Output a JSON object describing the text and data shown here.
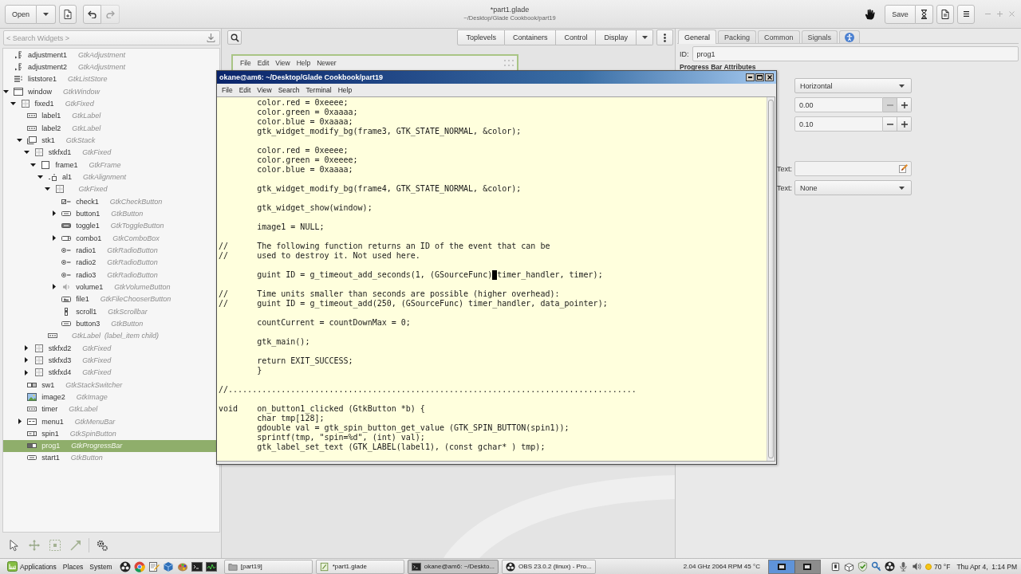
{
  "header": {
    "open_button": "Open",
    "title": "*part1.glade",
    "subtitle": "~/Desktop/Glade Cookbook/part19",
    "history": [
      {
        "kind": "undo",
        "disabled": false
      },
      {
        "kind": "redo",
        "disabled": true
      }
    ],
    "save_button": "Save"
  },
  "widget_tree": {
    "search": {
      "placeholder": "< Search Widgets >"
    },
    "items": [
      {
        "name": "adjustment1",
        "type": "GtkAdjustment",
        "kind": "adjustment",
        "selected": false
      },
      {
        "name": "adjustment2",
        "type": "GtkAdjustment",
        "kind": "adjustment",
        "selected": false
      },
      {
        "name": "liststore1",
        "type": "GtkListStore",
        "kind": "liststore",
        "selected": false
      },
      {
        "name": "window",
        "type": "GtkWindow",
        "kind": "window",
        "selected": false,
        "expanded": true,
        "children": [
          {
            "name": "fixed1",
            "type": "GtkFixed",
            "kind": "fixed",
            "selected": false,
            "expanded": true,
            "children": [
              {
                "name": "label1",
                "type": "GtkLabel",
                "kind": "label",
                "selected": false
              },
              {
                "name": "label2",
                "type": "GtkLabel",
                "kind": "label",
                "selected": false
              },
              {
                "name": "stk1",
                "type": "GtkStack",
                "kind": "stack",
                "selected": false,
                "expanded": true,
                "children": [
                  {
                    "name": "stkfxd1",
                    "type": "GtkFixed",
                    "kind": "fixed",
                    "selected": false,
                    "expanded": true,
                    "children": [
                      {
                        "name": "frame1",
                        "type": "GtkFrame",
                        "kind": "frame",
                        "selected": false,
                        "expanded": true,
                        "children": [
                          {
                            "name": "al1",
                            "type": "GtkAlignment",
                            "kind": "alignment",
                            "selected": false,
                            "expanded": true,
                            "children": [
                              {
                                "type": "GtkFixed",
                                "kind": "fixed",
                                "selected": false,
                                "expanded": true,
                                "children": [
                                  {
                                    "name": "check1",
                                    "type": "GtkCheckButton",
                                    "kind": "check",
                                    "selected": false
                                  },
                                  {
                                    "name": "button1",
                                    "type": "GtkButton",
                                    "kind": "button",
                                    "selected": false,
                                    "expanded": false
                                  },
                                  {
                                    "name": "toggle1",
                                    "type": "GtkToggleButton",
                                    "kind": "toggle",
                                    "selected": false
                                  },
                                  {
                                    "name": "combo1",
                                    "type": "GtkComboBox",
                                    "kind": "combo",
                                    "selected": false,
                                    "expanded": false
                                  },
                                  {
                                    "name": "radio1",
                                    "type": "GtkRadioButton",
                                    "kind": "radio",
                                    "selected": false
                                  },
                                  {
                                    "name": "radio2",
                                    "type": "GtkRadioButton",
                                    "kind": "radio",
                                    "selected": false
                                  },
                                  {
                                    "name": "radio3",
                                    "type": "GtkRadioButton",
                                    "kind": "radio",
                                    "selected": false
                                  },
                                  {
                                    "name": "volume1",
                                    "type": "GtkVolumeButton",
                                    "kind": "volume",
                                    "selected": false,
                                    "expanded": false
                                  },
                                  {
                                    "name": "file1",
                                    "type": "GtkFileChooserButton",
                                    "kind": "file",
                                    "selected": false
                                  },
                                  {
                                    "name": "scroll1",
                                    "type": "GtkScrollbar",
                                    "kind": "scrollbar",
                                    "selected": false
                                  },
                                  {
                                    "name": "button3",
                                    "type": "GtkButton",
                                    "kind": "button",
                                    "selected": false
                                  }
                                ]
                              }
                            ]
                          },
                          {
                            "type": "GtkLabel",
                            "note": "(label_item child)",
                            "kind": "label",
                            "selected": false
                          }
                        ]
                      }
                    ]
                  },
                  {
                    "name": "stkfxd2",
                    "type": "GtkFixed",
                    "kind": "fixed",
                    "selected": false,
                    "expanded": false
                  },
                  {
                    "name": "stkfxd3",
                    "type": "GtkFixed",
                    "kind": "fixed",
                    "selected": false,
                    "expanded": false
                  },
                  {
                    "name": "stkfxd4",
                    "type": "GtkFixed",
                    "kind": "fixed",
                    "selected": false,
                    "expanded": false
                  }
                ]
              },
              {
                "name": "sw1",
                "type": "GtkStackSwitcher",
                "kind": "switcher",
                "selected": false
              },
              {
                "name": "image2",
                "type": "GtkImage",
                "kind": "image",
                "selected": false
              },
              {
                "name": "timer",
                "type": "GtkLabel",
                "kind": "label",
                "selected": false
              },
              {
                "name": "menu1",
                "type": "GtkMenuBar",
                "kind": "menubar",
                "selected": false,
                "expanded": false
              },
              {
                "name": "spin1",
                "type": "GtkSpinButton",
                "kind": "spin",
                "selected": false
              },
              {
                "name": "prog1",
                "type": "GtkProgressBar",
                "kind": "progress",
                "selected": true
              },
              {
                "name": "start1",
                "type": "GtkButton",
                "kind": "button",
                "selected": false
              }
            ]
          }
        ]
      }
    ]
  },
  "editor_tools": [
    {
      "kind": "pointer"
    },
    {
      "kind": "move"
    },
    {
      "kind": "margins"
    },
    {
      "kind": "align"
    },
    {
      "kind": "settings"
    }
  ],
  "palette": {
    "groups": [
      "Toplevels",
      "Containers",
      "Control",
      "Display"
    ]
  },
  "design_window": {
    "menu": [
      "File",
      "Edit",
      "View",
      "Help",
      "Newer"
    ]
  },
  "terminal": {
    "title": "okane@am6: ~/Desktop/Glade Cookbook/part19",
    "menu": [
      "File",
      "Edit",
      "View",
      "Search",
      "Terminal",
      "Help"
    ],
    "blocks": [
      [
        "\tcolor.red = 0xeeee;",
        "\tcolor.green = 0xaaaa;",
        "\tcolor.blue = 0xaaaa;",
        "\tgtk_widget_modify_bg(frame3, GTK_STATE_NORMAL, &color);"
      ],
      [
        "\tcolor.red = 0xeeee;",
        "\tcolor.green = 0xeeee;",
        "\tcolor.blue = 0xaaaa;"
      ],
      [
        "\tgtk_widget_modify_bg(frame4, GTK_STATE_NORMAL, &color);"
      ],
      [
        "\tgtk_widget_show(window);"
      ],
      [
        "\timage1 = NULL;"
      ],
      [
        "//\tThe following function returns an ID of the event that can be",
        "//\tused to destroy it. Not used here."
      ],
      [
        {
          "text": "\tguint ID = g_timeout_add_seconds(1, (GSourceFunc)",
          "cursor": true,
          "rest": " timer_handler, timer);"
        }
      ],
      [
        "//\tTime units smaller than seconds are possible (higher overhead):",
        "//\tguint ID = g_timeout_add(250, (GSourceFunc) timer_handler, data_pointer);"
      ],
      [
        "\tcountCurrent = countDownMax = 0;"
      ],
      [
        "\tgtk_main();"
      ],
      [
        "\treturn EXIT_SUCCESS;",
        "\t}"
      ],
      [
        "//....................................................................................."
      ],
      [
        "void\ton_button1_clicked (GtkButton *b) {",
        "\tchar tmp[128];",
        "\tgdouble val = gtk_spin_button_get_value (GTK_SPIN_BUTTON(spin1));",
        "\tsprintf(tmp, \"spin=%d\", (int) val);",
        "\tgtk_label_set_text (GTK_LABEL(label1), (const gchar* ) tmp);"
      ]
    ]
  },
  "properties": {
    "tabs": [
      {
        "kind": "text",
        "label": "General",
        "selected": true
      },
      {
        "kind": "text",
        "label": "Packing",
        "selected": false
      },
      {
        "kind": "text",
        "label": "Common",
        "selected": false
      },
      {
        "kind": "text",
        "label": "Signals",
        "selected": false
      },
      {
        "kind": "accessibility",
        "selected": false
      }
    ],
    "id": {
      "label": "ID:",
      "value": "prog1"
    },
    "heading": "Progress Bar Attributes",
    "fields": [
      {
        "kind": "dropdown",
        "value": "Horizontal"
      },
      {
        "kind": "spin",
        "value": "0.00",
        "decrement_disabled": true
      },
      {
        "kind": "spin",
        "value": "0.10",
        "decrement_disabled": false
      },
      {
        "kind": "entry",
        "label": "Text:"
      },
      {
        "kind": "dropdown",
        "label": "Text:",
        "value": "None"
      }
    ]
  },
  "taskbar": {
    "menus": [
      "Applications",
      "Places",
      "System"
    ],
    "launchers": [
      {
        "kind": "obs"
      },
      {
        "kind": "browser"
      },
      {
        "kind": "editor"
      },
      {
        "kind": "vm"
      },
      {
        "kind": "paint"
      },
      {
        "kind": "terminal"
      },
      {
        "kind": "monitor"
      }
    ],
    "tasks": [
      {
        "kind": "folder",
        "label": "[part19]",
        "selected": false
      },
      {
        "kind": "glade",
        "label": "*part1.glade",
        "selected": false
      },
      {
        "kind": "terminal",
        "label": "okane@am6: ~/Deskto...",
        "selected": true
      },
      {
        "kind": "obs",
        "label": "OBS 23.0.2 (linux) - Pro...",
        "selected": false
      }
    ],
    "system_monitor": "2.04 GHz 2064 RPM 45 °C",
    "workspaces": [
      {
        "selected": true
      },
      {
        "selected": false
      }
    ],
    "tray": [
      {
        "kind": "device"
      },
      {
        "kind": "box"
      },
      {
        "kind": "check"
      },
      {
        "kind": "key"
      },
      {
        "kind": "obs"
      },
      {
        "kind": "mic"
      },
      {
        "kind": "speaker"
      }
    ],
    "temperature": "70 °F",
    "clock": "Thu Apr 4,  1:14 PM"
  }
}
